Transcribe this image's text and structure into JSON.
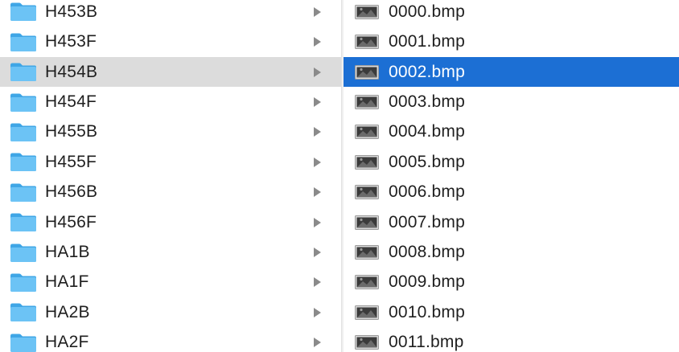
{
  "folders": [
    {
      "name": "H453B"
    },
    {
      "name": "H453F"
    },
    {
      "name": "H454B"
    },
    {
      "name": "H454F"
    },
    {
      "name": "H455B"
    },
    {
      "name": "H455F"
    },
    {
      "name": "H456B"
    },
    {
      "name": "H456F"
    },
    {
      "name": "HA1B"
    },
    {
      "name": "HA1F"
    },
    {
      "name": "HA2B"
    },
    {
      "name": "HA2F"
    }
  ],
  "selected_folder": "H454B",
  "files": [
    {
      "name": "0000.bmp"
    },
    {
      "name": "0001.bmp"
    },
    {
      "name": "0002.bmp"
    },
    {
      "name": "0003.bmp"
    },
    {
      "name": "0004.bmp"
    },
    {
      "name": "0005.bmp"
    },
    {
      "name": "0006.bmp"
    },
    {
      "name": "0007.bmp"
    },
    {
      "name": "0008.bmp"
    },
    {
      "name": "0009.bmp"
    },
    {
      "name": "0010.bmp"
    },
    {
      "name": "0011.bmp"
    }
  ],
  "selected_file": "0002.bmp",
  "icons": {
    "folder": "folder-icon",
    "file": "image-file-icon",
    "disclosure": "disclosure-triangle-icon"
  },
  "colors": {
    "selection_active": "#1c6fd4",
    "selection_inactive": "#dcdcdc",
    "folder_blue": "#5ab8f0"
  }
}
